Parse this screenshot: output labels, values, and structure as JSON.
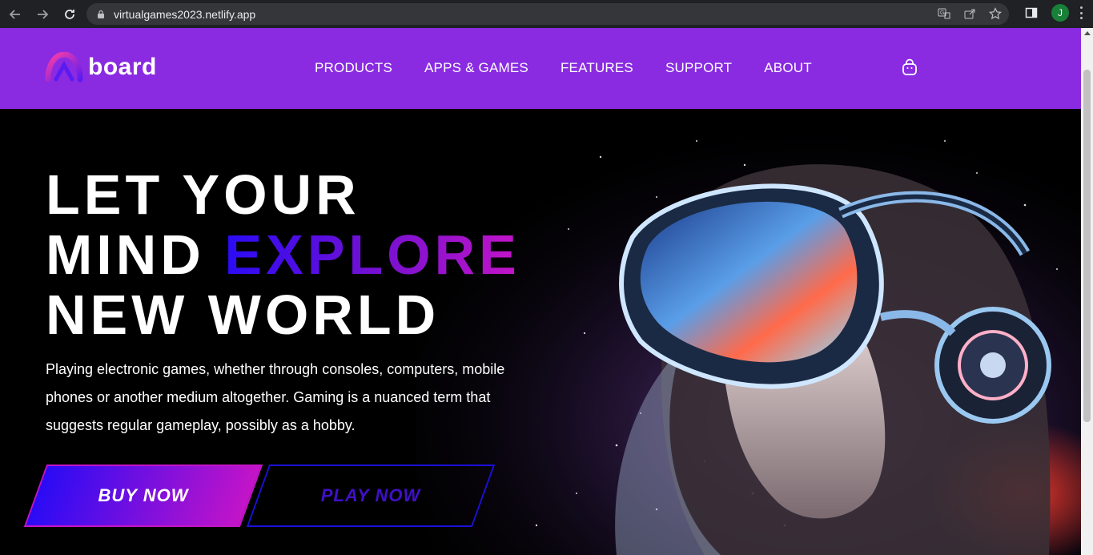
{
  "browser": {
    "url": "virtualgames2023.netlify.app",
    "profile_initial": "J",
    "icons": [
      "back-icon",
      "forward-icon",
      "reload-icon",
      "lock-icon",
      "translate-icon",
      "share-icon",
      "star-icon",
      "side-panel-icon",
      "menu-icon"
    ]
  },
  "header": {
    "logo_text": "board",
    "menu": [
      {
        "label": "PRODUCTS"
      },
      {
        "label": "APPS & GAMES"
      },
      {
        "label": "FEATURES"
      },
      {
        "label": "SUPPORT"
      },
      {
        "label": "ABOUT"
      }
    ],
    "cart_icon": "shopping-bag-icon"
  },
  "hero": {
    "line1": "LET YOUR",
    "line2_plain": "MIND",
    "line2_highlight": "EXPLORE",
    "line3": "NEW WORLD",
    "description": "Playing electronic games, whether through consoles, computers, mobile phones or another medium altogether. Gaming is a nuanced term that suggests regular gameplay, possibly as a hobby.",
    "buy_label": "BUY NOW",
    "play_label": "PLAY NOW"
  },
  "colors": {
    "header_bg": "#8a2be2",
    "gradient_start": "#2a0bf5",
    "gradient_end": "#c414c8",
    "chrome_bg": "#202124"
  }
}
